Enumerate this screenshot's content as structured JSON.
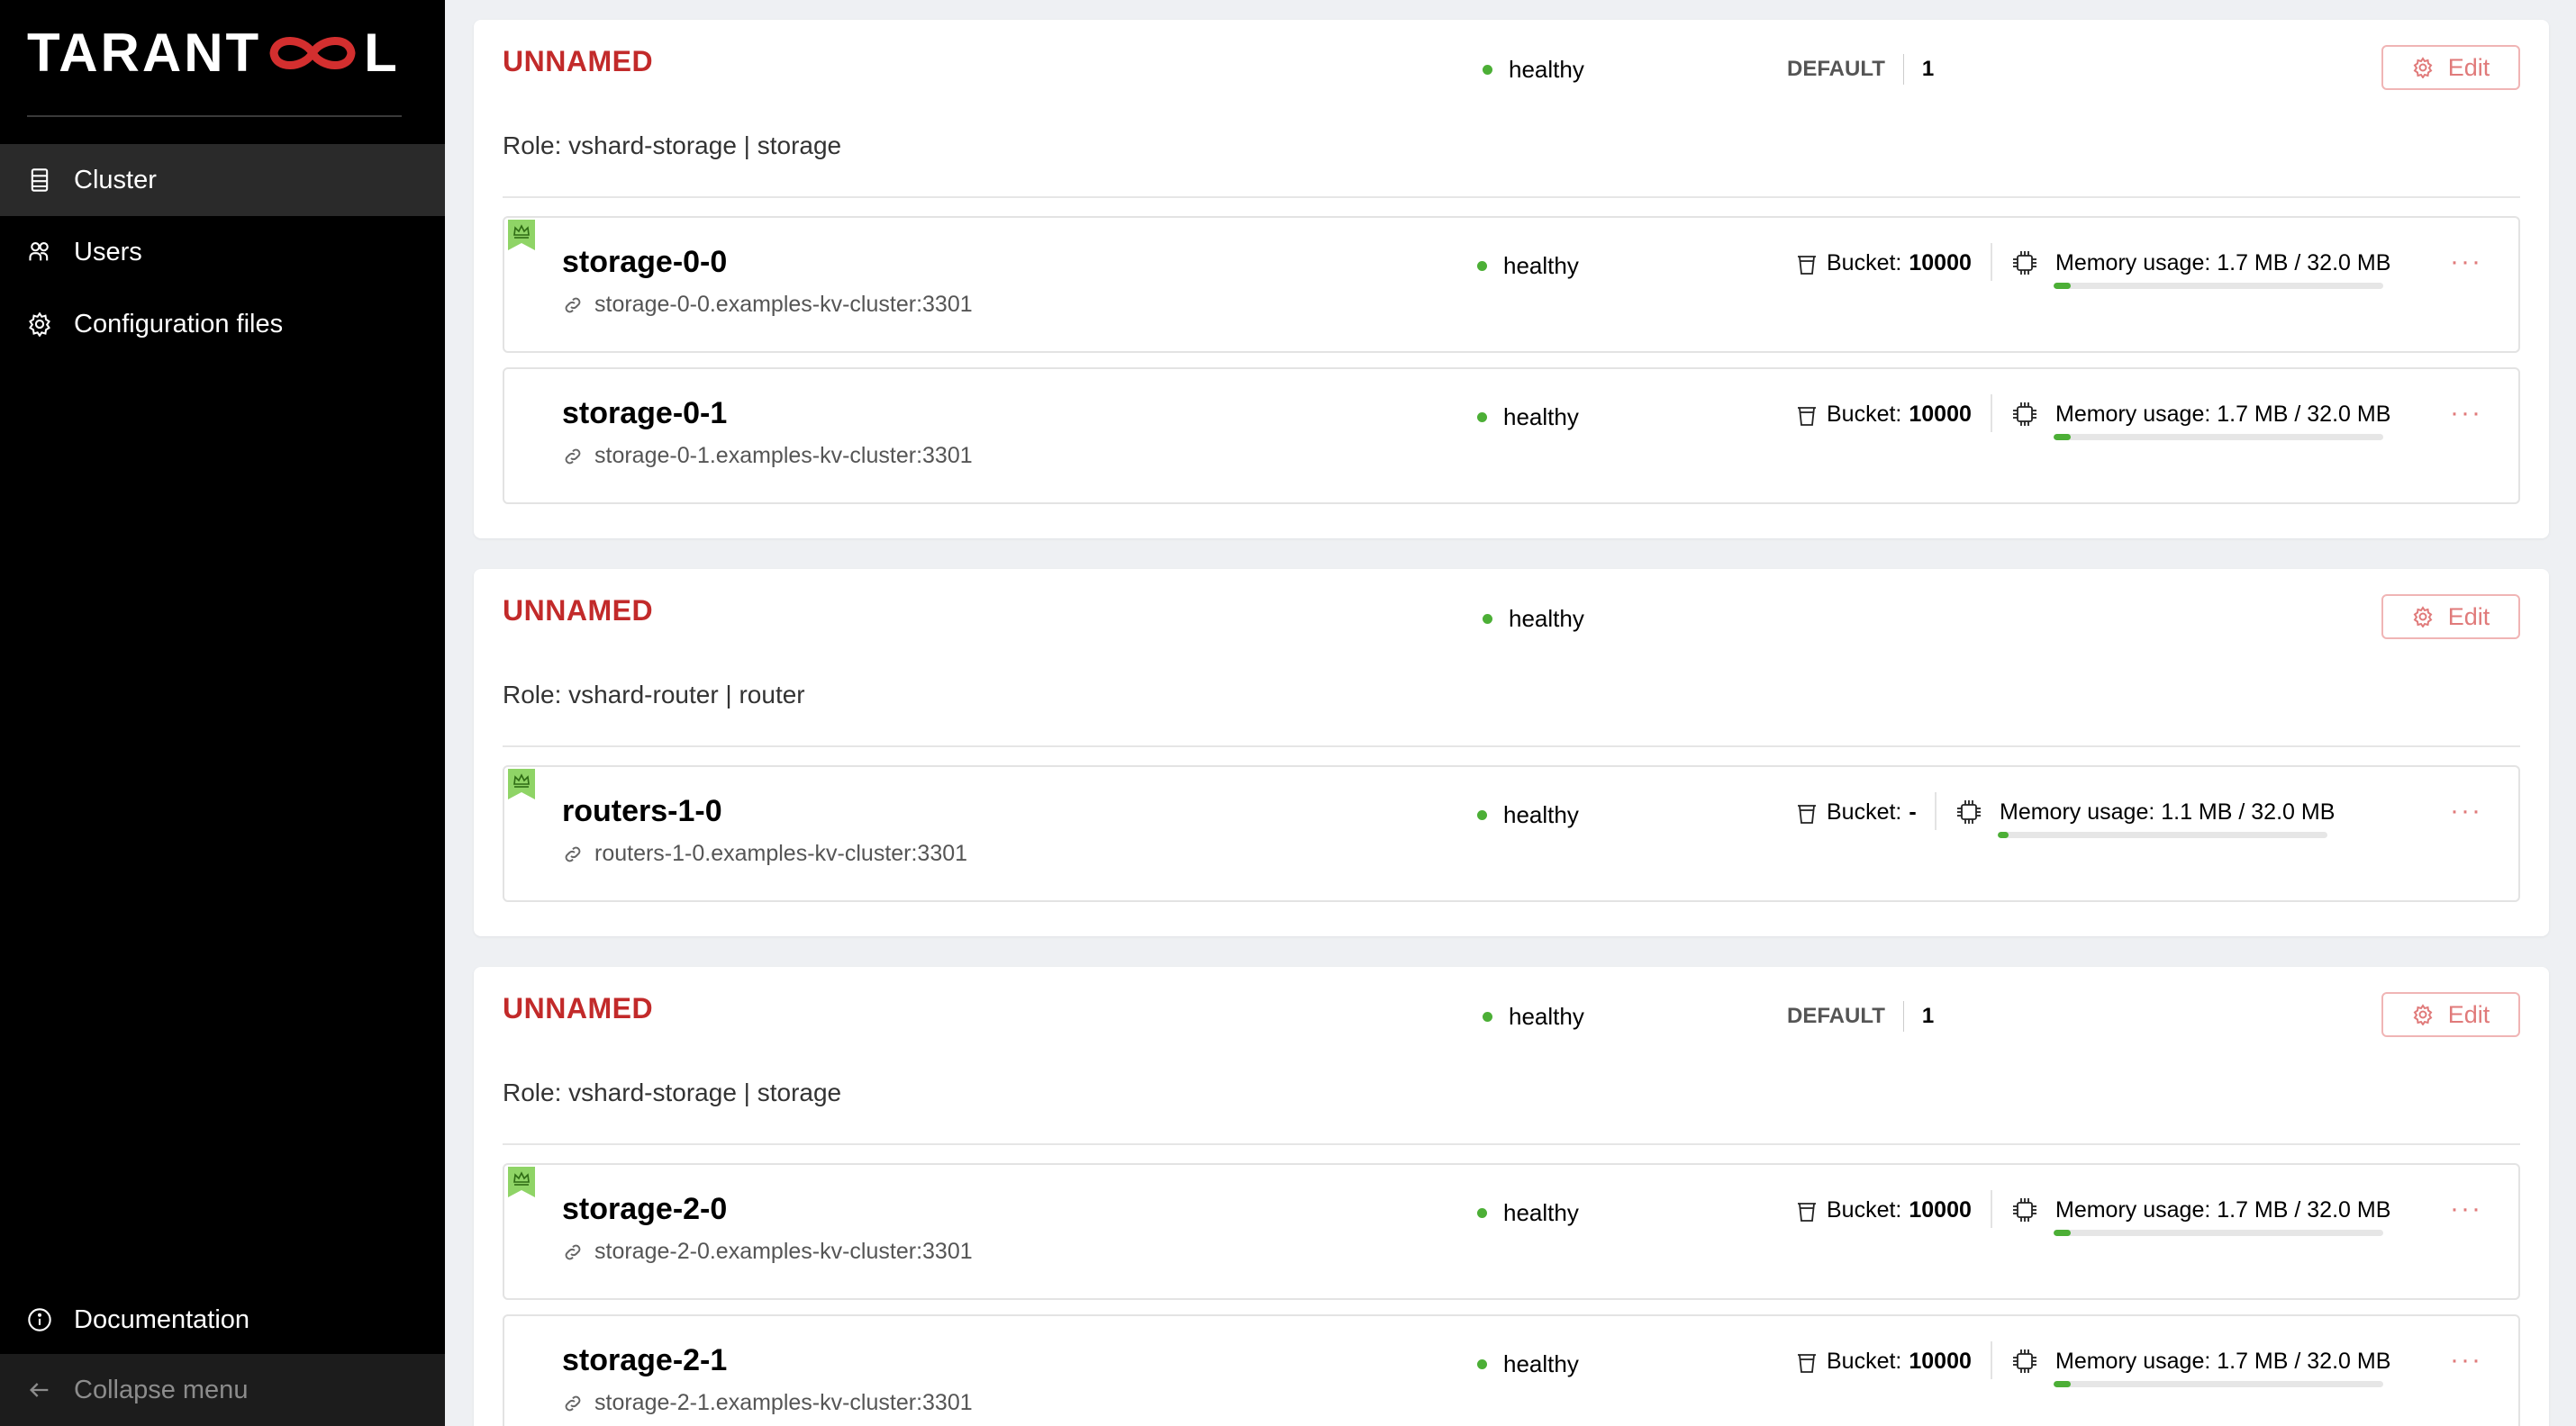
{
  "sidebar": {
    "logo": {
      "left": "TARANT",
      "right": "L"
    },
    "items": [
      {
        "label": "Cluster",
        "icon": "server-icon"
      },
      {
        "label": "Users",
        "icon": "users-icon"
      },
      {
        "label": "Configuration files",
        "icon": "gear-icon"
      }
    ],
    "documentation": "Documentation",
    "collapse": "Collapse menu"
  },
  "groups": [
    {
      "title": "UNNAMED",
      "status": "healthy",
      "weight_label": "DEFAULT",
      "weight_value": "1",
      "edit_label": "Edit",
      "role": "Role: vshard-storage | storage",
      "servers": [
        {
          "name": "storage-0-0",
          "uri": "storage-0-0.examples-kv-cluster:3301",
          "status": "healthy",
          "bucket_label": "Bucket:",
          "bucket_value": "10000",
          "memory": "Memory usage: 1.7 MB / 32.0 MB",
          "memory_fraction": 0.053,
          "leader": true,
          "more": "···"
        },
        {
          "name": "storage-0-1",
          "uri": "storage-0-1.examples-kv-cluster:3301",
          "status": "healthy",
          "bucket_label": "Bucket:",
          "bucket_value": "10000",
          "memory": "Memory usage: 1.7 MB / 32.0 MB",
          "memory_fraction": 0.053,
          "leader": false,
          "more": "···"
        }
      ]
    },
    {
      "title": "UNNAMED",
      "status": "healthy",
      "edit_label": "Edit",
      "role": "Role: vshard-router | router",
      "servers": [
        {
          "name": "routers-1-0",
          "uri": "routers-1-0.examples-kv-cluster:3301",
          "status": "healthy",
          "bucket_label": "Bucket:",
          "bucket_value": "-",
          "memory": "Memory usage: 1.1 MB / 32.0 MB",
          "memory_fraction": 0.034,
          "leader": true,
          "more": "···"
        }
      ]
    },
    {
      "title": "UNNAMED",
      "status": "healthy",
      "weight_label": "DEFAULT",
      "weight_value": "1",
      "edit_label": "Edit",
      "role": "Role: vshard-storage | storage",
      "servers": [
        {
          "name": "storage-2-0",
          "uri": "storage-2-0.examples-kv-cluster:3301",
          "status": "healthy",
          "bucket_label": "Bucket:",
          "bucket_value": "10000",
          "memory": "Memory usage: 1.7 MB / 32.0 MB",
          "memory_fraction": 0.053,
          "leader": true,
          "more": "···"
        },
        {
          "name": "storage-2-1",
          "uri": "storage-2-1.examples-kv-cluster:3301",
          "status": "healthy",
          "bucket_label": "Bucket:",
          "bucket_value": "10000",
          "memory": "Memory usage: 1.7 MB / 32.0 MB",
          "memory_fraction": 0.053,
          "leader": false,
          "more": "···"
        }
      ]
    }
  ],
  "colors": {
    "accent_red": "#c22a2a",
    "healthy_green": "#4caf36",
    "sidebar_bg": "#000000",
    "page_bg": "#eef0f3"
  }
}
